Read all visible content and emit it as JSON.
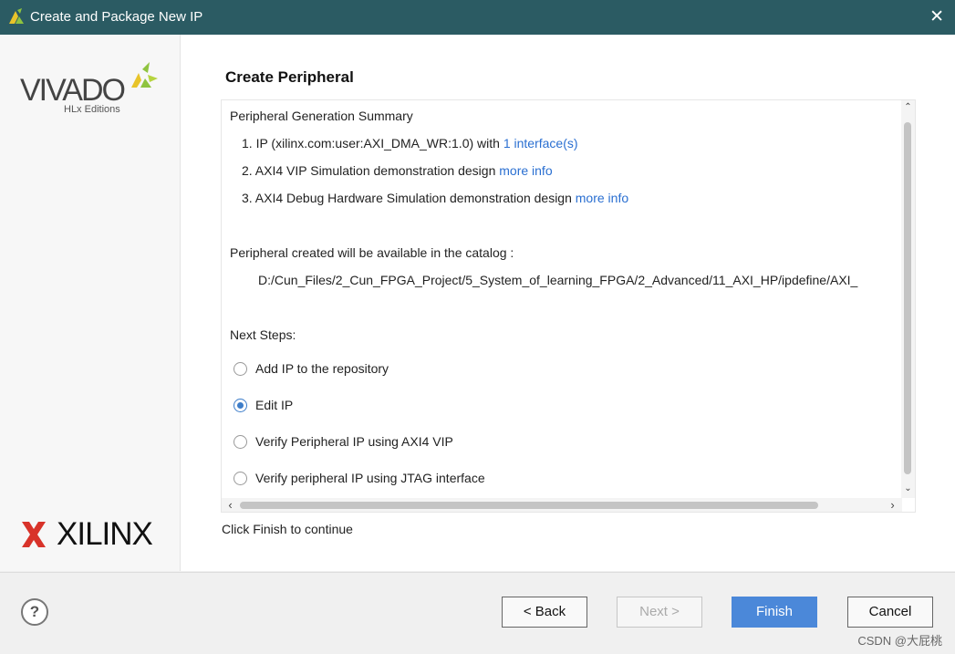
{
  "window": {
    "title": "Create and Package New IP",
    "close_icon": "close-icon"
  },
  "sidebar": {
    "vivado_logo_text": "VIVADO",
    "vivado_sub_text": "HLx Editions",
    "xilinx_logo_text": "XILINX"
  },
  "page": {
    "title": "Create Peripheral"
  },
  "summary": {
    "heading": "Peripheral Generation Summary",
    "item1_text": "1. IP (xilinx.com:user:AXI_DMA_WR:1.0) with",
    "item1_link": "1 interface(s)",
    "item2_text": "2. AXI4 VIP Simulation demonstration design",
    "item2_link": "more info",
    "item3_text": "3. AXI4 Debug Hardware Simulation demonstration design",
    "item3_link": "more info",
    "catalog_label": "Peripheral created will be available in the catalog :",
    "catalog_path": "D:/Cun_Files/2_Cun_FPGA_Project/5_System_of_learning_FPGA/2_Advanced/11_AXI_HP/ipdefine/AXI_"
  },
  "next_steps": {
    "label": "Next Steps:",
    "options": [
      {
        "label": "Add IP to the repository",
        "checked": false
      },
      {
        "label": "Edit IP",
        "checked": true
      },
      {
        "label": "Verify Peripheral IP using AXI4 VIP",
        "checked": false
      },
      {
        "label": "Verify peripheral IP using JTAG interface",
        "checked": false
      }
    ]
  },
  "hint": "Click Finish to continue",
  "footer": {
    "help_label": "?",
    "back_label": "< Back",
    "next_label": "Next >",
    "finish_label": "Finish",
    "cancel_label": "Cancel"
  },
  "watermark": "CSDN @大屁桃",
  "colors": {
    "titlebar": "#2b5b63",
    "link": "#2a6fd1",
    "primary_button": "#4b88d9"
  }
}
